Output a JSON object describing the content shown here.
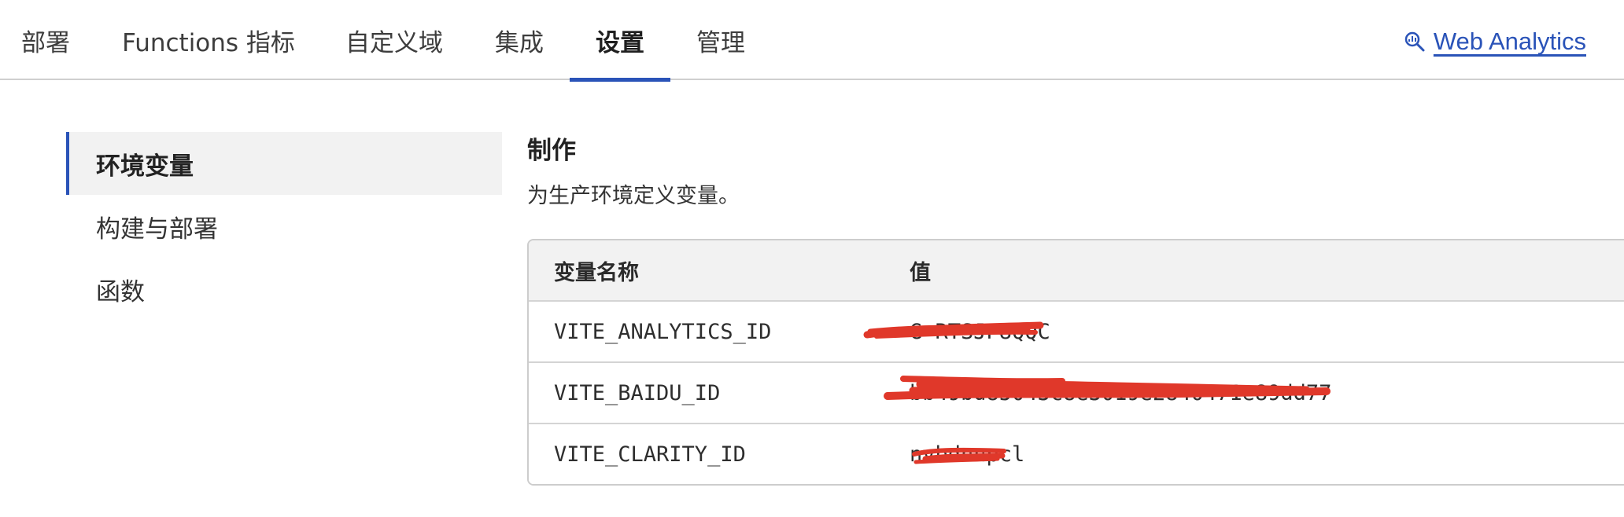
{
  "tabs": [
    {
      "label": "部署"
    },
    {
      "label": "Functions 指标"
    },
    {
      "label": "自定义域"
    },
    {
      "label": "集成"
    },
    {
      "label": "设置",
      "active": true
    },
    {
      "label": "管理"
    }
  ],
  "header_link": {
    "label": "Web Analytics",
    "icon": "analytics-search-icon"
  },
  "sidebar": {
    "items": [
      {
        "label": "环境变量",
        "active": true
      },
      {
        "label": "构建与部署"
      },
      {
        "label": "函数"
      }
    ]
  },
  "section": {
    "title": "制作",
    "description": "为生产环境定义变量。"
  },
  "table": {
    "columns": [
      "变量名称",
      "值"
    ],
    "rows": [
      {
        "name": "VITE_ANALYTICS_ID",
        "value": "G-RTSJP8QQC",
        "redacted": true
      },
      {
        "name": "VITE_BAIDU_ID",
        "value": "bb49bd85043c8e3019e2840471e89dd77",
        "redacted": true
      },
      {
        "name": "VITE_CLARITY_ID",
        "value": "nvbdnnpcl",
        "redacted": true
      }
    ]
  },
  "colors": {
    "accent": "#2a53b8",
    "redaction": "#e0382a",
    "header_bg": "#f2f2f2",
    "border": "#cdcdcd"
  }
}
